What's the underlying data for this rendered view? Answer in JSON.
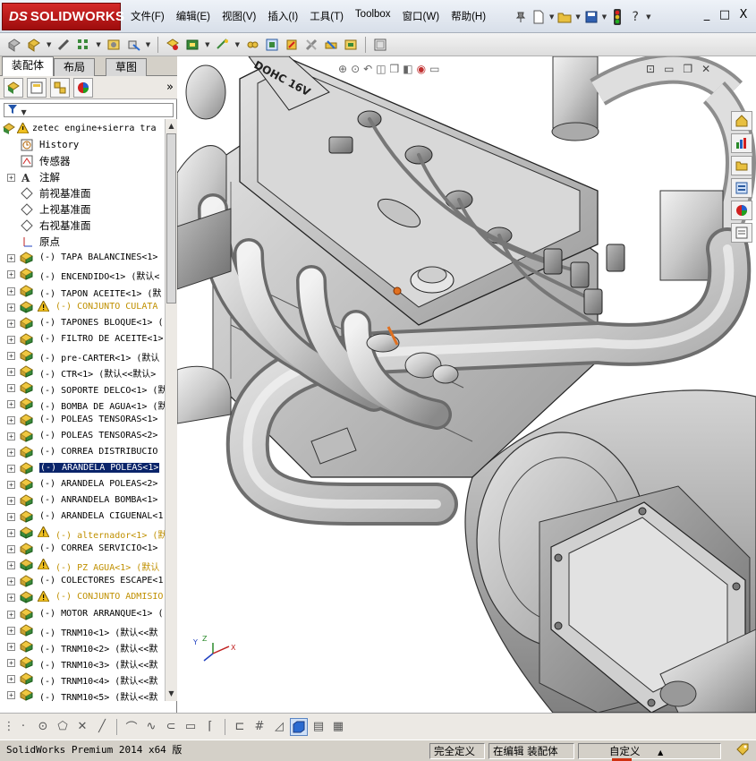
{
  "app": {
    "logo_ds": "DS",
    "logo_brand": "SOLIDWORKS"
  },
  "menu": [
    {
      "label": "文件(F)"
    },
    {
      "label": "编辑(E)"
    },
    {
      "label": "视图(V)"
    },
    {
      "label": "插入(I)"
    },
    {
      "label": "工具(T)"
    },
    {
      "label": "Toolbox"
    },
    {
      "label": "窗口(W)"
    },
    {
      "label": "帮助(H)"
    }
  ],
  "quick_access_icons": [
    "pin-icon",
    "new-doc-icon",
    "open-folder-icon",
    "save-icon",
    "traffic-light-icon",
    "help-icon"
  ],
  "help_glyph": "?",
  "window_controls": [
    "_",
    "□",
    "X"
  ],
  "feature_tabs": [
    {
      "label": "装配体",
      "active": true
    },
    {
      "label": "布局",
      "active": false
    },
    {
      "label": "草图",
      "active": false
    }
  ],
  "tree": {
    "root": "zetec engine+sierra tra",
    "items": [
      {
        "label": "History",
        "kind": "history",
        "expand": false
      },
      {
        "label": "传感器",
        "kind": "sensor",
        "expand": false
      },
      {
        "label": "注解",
        "kind": "annotation",
        "expand": true
      },
      {
        "label": "前视基准面",
        "kind": "plane",
        "expand": false
      },
      {
        "label": "上视基准面",
        "kind": "plane",
        "expand": false
      },
      {
        "label": "右视基准面",
        "kind": "plane",
        "expand": false
      },
      {
        "label": "原点",
        "kind": "origin",
        "expand": false
      },
      {
        "label": "(-) TAPA BALANCINES<1>",
        "kind": "part",
        "expand": true
      },
      {
        "label": "(-) ENCENDIDO<1> (默认<",
        "kind": "part",
        "expand": true
      },
      {
        "label": "(-) TAPON ACEITE<1> (默",
        "kind": "part",
        "expand": true
      },
      {
        "label": "(-) CONJUNTO CULATA",
        "kind": "assembly-warn",
        "expand": true
      },
      {
        "label": "(-) TAPONES BLOQUE<1> (",
        "kind": "part",
        "expand": true
      },
      {
        "label": "(-) FILTRO DE ACEITE<1>",
        "kind": "part",
        "expand": true
      },
      {
        "label": "(-) pre-CARTER<1> (默认",
        "kind": "part",
        "expand": true
      },
      {
        "label": "(-) CTR<1> (默认<<默认>",
        "kind": "part",
        "expand": true
      },
      {
        "label": "(-) SOPORTE DELCO<1> (默",
        "kind": "part",
        "expand": true
      },
      {
        "label": "(-) BOMBA DE AGUA<1> (默",
        "kind": "part",
        "expand": true
      },
      {
        "label": "(-) POLEAS TENSORAS<1>",
        "kind": "part",
        "expand": true
      },
      {
        "label": "(-) POLEAS TENSORAS<2>",
        "kind": "part",
        "expand": true
      },
      {
        "label": "(-) CORREA DISTRIBUCIO",
        "kind": "part",
        "expand": true
      },
      {
        "label": "(-) ARANDELA POLEAS<1>",
        "kind": "part-selected",
        "expand": true
      },
      {
        "label": "(-) ARANDELA POLEAS<2>",
        "kind": "part",
        "expand": true
      },
      {
        "label": "(-) ANRANDELA BOMBA<1>",
        "kind": "part",
        "expand": true
      },
      {
        "label": "(-) ARANDELA CIGUENAL<1",
        "kind": "part",
        "expand": true
      },
      {
        "label": "(-) alternador<1> (默",
        "kind": "assembly-warn",
        "expand": true
      },
      {
        "label": "(-) CORREA SERVICIO<1>",
        "kind": "part",
        "expand": true
      },
      {
        "label": "(-) PZ AGUA<1> (默认",
        "kind": "assembly-warn",
        "expand": true
      },
      {
        "label": "(-) COLECTORES ESCAPE<1",
        "kind": "part",
        "expand": true
      },
      {
        "label": "(-) CONJUNTO ADMISIO",
        "kind": "assembly-warn",
        "expand": true
      },
      {
        "label": "(-) MOTOR ARRANQUE<1> (",
        "kind": "part",
        "expand": true
      },
      {
        "label": "(-) TRNM10<1> (默认<<默",
        "kind": "part",
        "expand": true
      },
      {
        "label": "(-) TRNM10<2> (默认<<默",
        "kind": "part",
        "expand": true
      },
      {
        "label": "(-) TRNM10<3> (默认<<默",
        "kind": "part",
        "expand": true
      },
      {
        "label": "(-) TRNM10<4> (默认<<默",
        "kind": "part",
        "expand": true
      },
      {
        "label": "(-) TRNM10<5> (默认<<默",
        "kind": "part",
        "expand": true
      }
    ]
  },
  "graphics": {
    "cover_text": "DOHC 16V",
    "triad_labels": {
      "x": "X",
      "y": "Y",
      "z": "Z"
    }
  },
  "status": {
    "app": "SolidWorks Premium 2014 x64 版",
    "defined": "完全定义",
    "editing": "在编辑 装配体",
    "custom": "自定义",
    "custom_arrow": "▲"
  },
  "colors": {
    "accent_red": "#b01818",
    "selection": "#0a246a",
    "warning": "#d09000",
    "metal_light": "#d8d8d8",
    "metal_dark": "#8a8a8a"
  }
}
